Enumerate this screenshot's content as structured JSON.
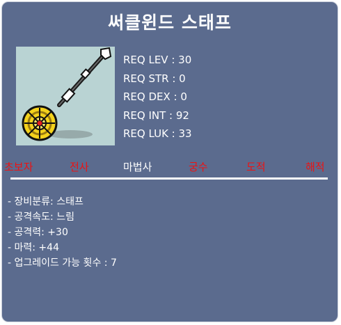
{
  "item": {
    "name": "써클윈드 스태프",
    "icon": "circle-wind-staff-icon"
  },
  "requirements": [
    "REQ LEV : 30",
    "REQ STR : 0",
    "REQ DEX : 0",
    "REQ INT : 92",
    "REQ LUK : 33"
  ],
  "jobs": [
    {
      "label": "초보자",
      "available": false,
      "color": "#ee1111"
    },
    {
      "label": "전사",
      "available": false,
      "color": "#ee1111"
    },
    {
      "label": "마법사",
      "available": true,
      "color": "#ffffff"
    },
    {
      "label": "궁수",
      "available": false,
      "color": "#ee1111"
    },
    {
      "label": "도적",
      "available": false,
      "color": "#ee1111"
    },
    {
      "label": "해적",
      "available": false,
      "color": "#ee1111"
    }
  ],
  "stats": [
    "- 장비분류: 스태프",
    "- 공격속도: 느림",
    "- 공격력: +30",
    "- 마력: +44",
    "- 업그레이드 가능 횟수 : 7"
  ],
  "colors": {
    "panel": "#5b6b8e",
    "unavailable_job": "#ee1111",
    "available_job": "#ffffff"
  }
}
